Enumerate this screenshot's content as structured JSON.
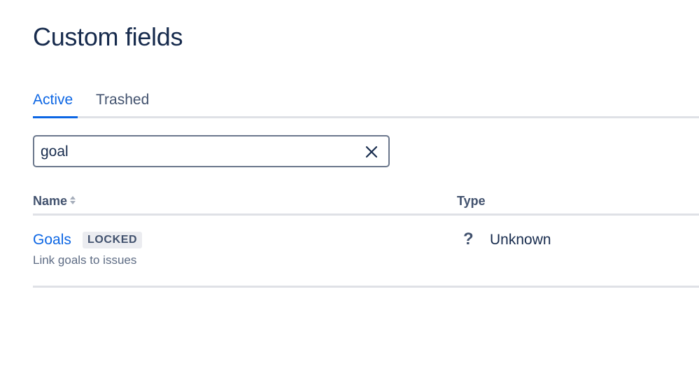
{
  "page": {
    "title": "Custom fields"
  },
  "tabs": [
    {
      "label": "Active",
      "selected": true
    },
    {
      "label": "Trashed",
      "selected": false
    }
  ],
  "search": {
    "value": "goal",
    "clear_icon": "close-icon"
  },
  "table": {
    "columns": [
      {
        "label": "Name",
        "sortable": true,
        "icon": "sort-icon"
      },
      {
        "label": "Type",
        "sortable": false
      }
    ],
    "rows": [
      {
        "name": "Goals",
        "lozenge": "LOCKED",
        "description": "Link goals to issues",
        "type_icon": "?",
        "type": "Unknown"
      }
    ]
  },
  "colors": {
    "accent": "#0c66e4",
    "text": "#172b4d",
    "subtle_text": "#42526e",
    "border": "#dfe1e6",
    "lozenge_bg": "#ebecf0"
  }
}
